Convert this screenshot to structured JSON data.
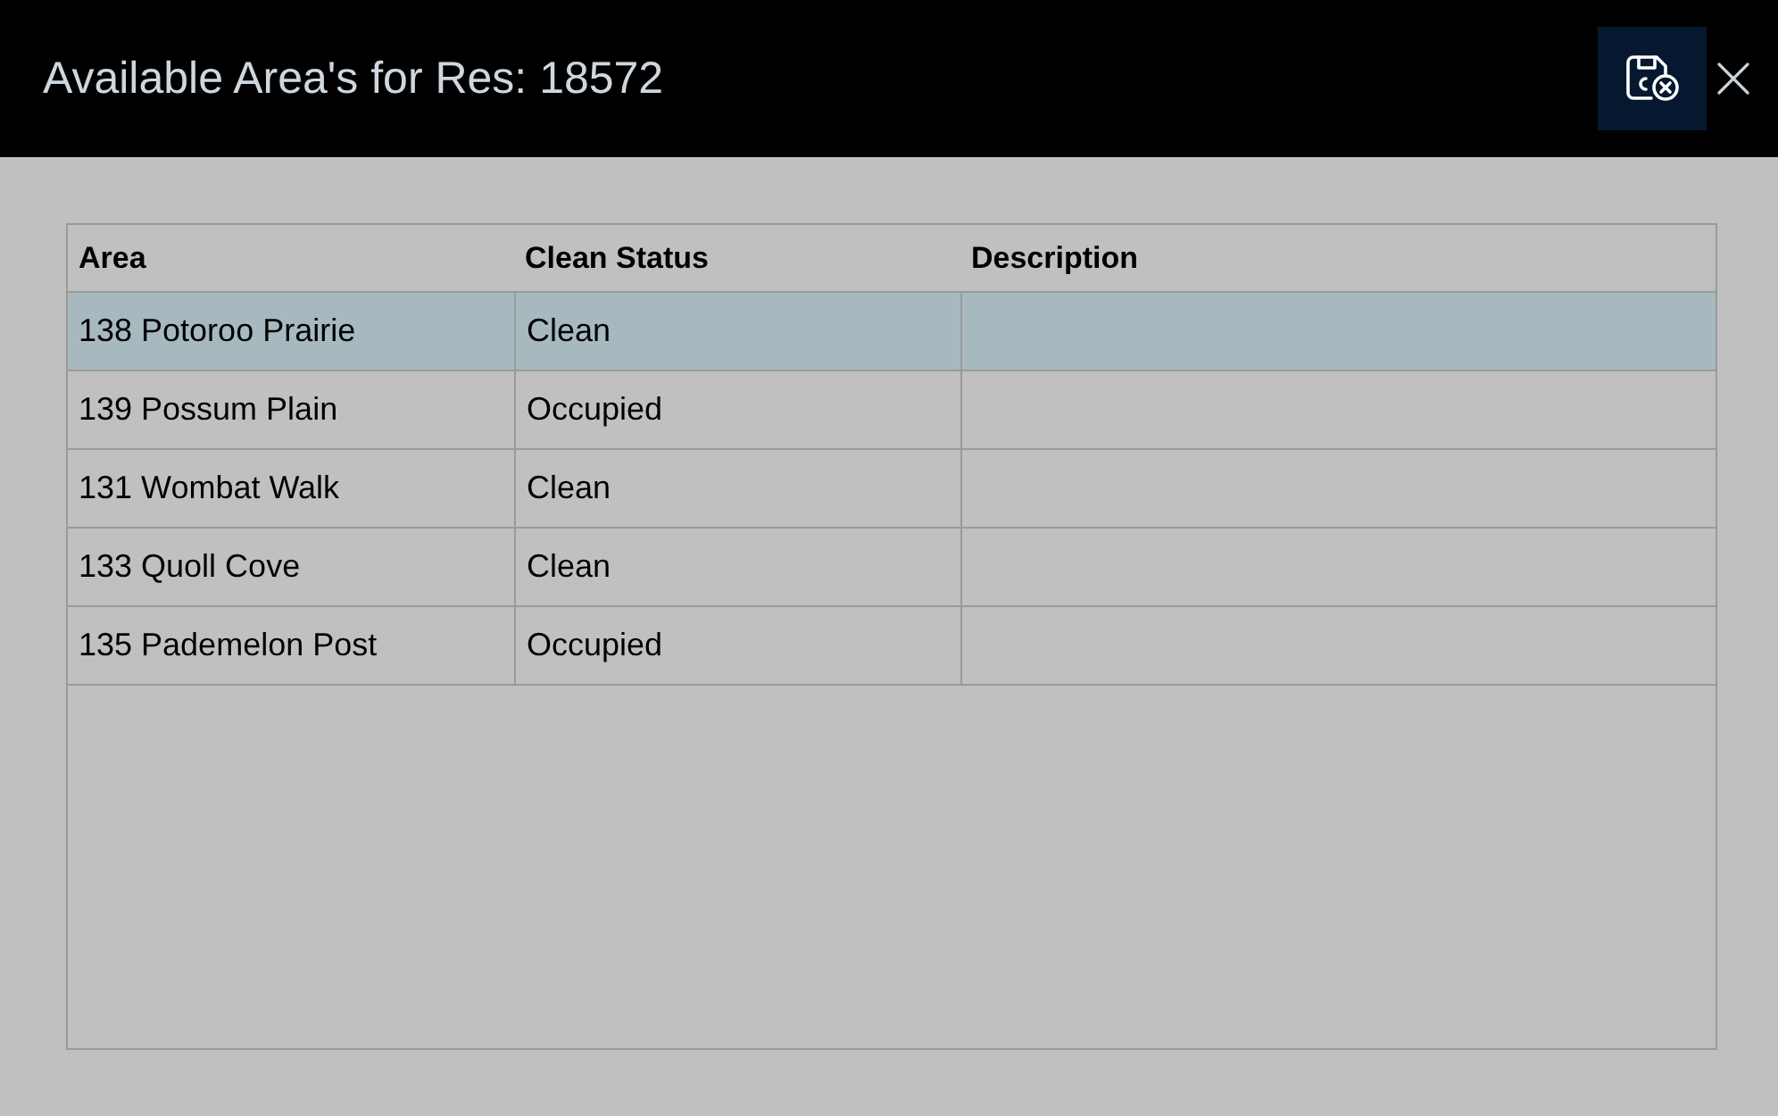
{
  "window": {
    "title": "Available Area's for Res: 18572"
  },
  "table": {
    "columns": [
      "Area",
      "Clean Status",
      "Description"
    ],
    "rows": [
      {
        "cells": [
          "138 Potoroo Prairie",
          "Clean"
        ],
        "selected": true
      },
      {
        "cells": [
          "139 Possum Plain",
          "Occupied"
        ],
        "selected": false
      },
      {
        "cells": [
          "131 Wombat Walk",
          "Clean"
        ],
        "selected": false
      },
      {
        "cells": [
          "133 Quoll Cove",
          "Clean"
        ],
        "selected": false
      },
      {
        "cells": [
          "135 Pademelon Post",
          "Occupied"
        ],
        "selected": false
      }
    ]
  }
}
